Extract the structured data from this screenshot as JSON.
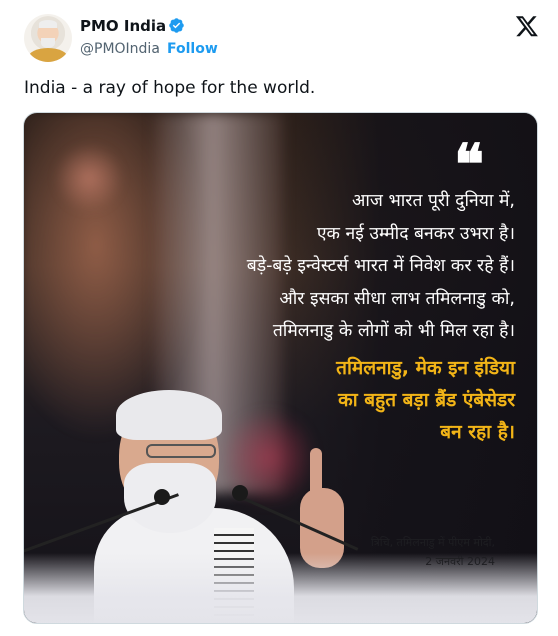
{
  "author": {
    "name": "PMO India",
    "handle": "@PMOIndia",
    "separator": "·",
    "follow_label": "Follow",
    "verified_icon": "verified-badge-icon",
    "verified_color": "#1d9bf0"
  },
  "platform_logo": "x-logo-icon",
  "tweet": {
    "text": "India - a ray of hope for the world."
  },
  "media": {
    "quote_mark": "❝",
    "quote_lines": [
      "आज भारत पूरी दुनिया में,",
      "एक नई उम्मीद बनकर उभरा है।",
      "बड़े-बड़े इन्वेस्टर्स भारत में निवेश कर रहे हैं।",
      "और इसका सीधा लाभ तमिलनाडु को,",
      "तमिलनाडु के लोगों को भी मिल रहा है।"
    ],
    "highlight_lines": [
      "तमिलनाडु, मेक इन इंडिया",
      "का बहुत बड़ा ब्रैंड एंबेसेडर",
      "बन रहा है।"
    ],
    "highlight_color": "#f2b417",
    "caption_lines": [
      "त्रिचि, तमिलनाडु में पीएम मोदी,",
      "2 जनवरी 2024"
    ]
  }
}
